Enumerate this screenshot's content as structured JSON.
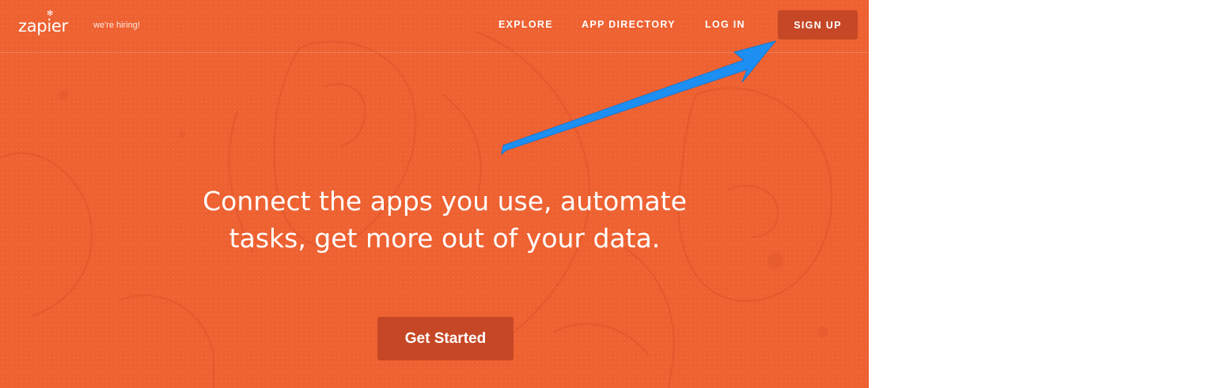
{
  "nav": {
    "logo": "zapier",
    "hiring": "we're hiring!",
    "links": [
      "EXPLORE",
      "APP DIRECTORY",
      "LOG IN"
    ],
    "signup": "SIGN UP"
  },
  "hero": {
    "headline_line1": "Connect the apps you use, automate",
    "headline_line2": "tasks, get more out of your data.",
    "cta": "Get Started"
  },
  "colors": {
    "brand_orange": "#ee6131",
    "button_dark": "#c64725",
    "annotation_arrow": "#1e8ff2"
  },
  "icons": {
    "logo_mark": "asterisk-icon",
    "annotation": "arrow-annotation"
  }
}
